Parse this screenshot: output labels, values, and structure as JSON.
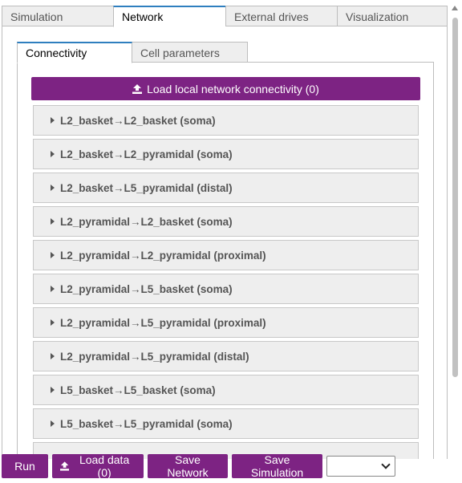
{
  "main_tabs": [
    "Simulation",
    "Network",
    "External drives",
    "Visualization"
  ],
  "sub_tabs": [
    "Connectivity",
    "Cell parameters"
  ],
  "load_connectivity_label": "Load local network connectivity (0)",
  "connections": [
    "L2_basket→L2_basket (soma)",
    "L2_basket→L2_pyramidal (soma)",
    "L2_basket→L5_pyramidal (distal)",
    "L2_pyramidal→L2_basket (soma)",
    "L2_pyramidal→L2_pyramidal (proximal)",
    "L2_pyramidal→L5_basket (soma)",
    "L2_pyramidal→L5_pyramidal (proximal)",
    "L2_pyramidal→L5_pyramidal (distal)",
    "L5_basket→L5_basket (soma)",
    "L5_basket→L5_pyramidal (soma)",
    ""
  ],
  "buttons": {
    "run": "Run",
    "load_data": "Load data (0)",
    "save_network": "Save Network",
    "save_simulation": "Save Simulation"
  },
  "dropdown_value": "",
  "colors": {
    "accent": "#7d2383",
    "tab_active_border": "#2f7fbf"
  }
}
